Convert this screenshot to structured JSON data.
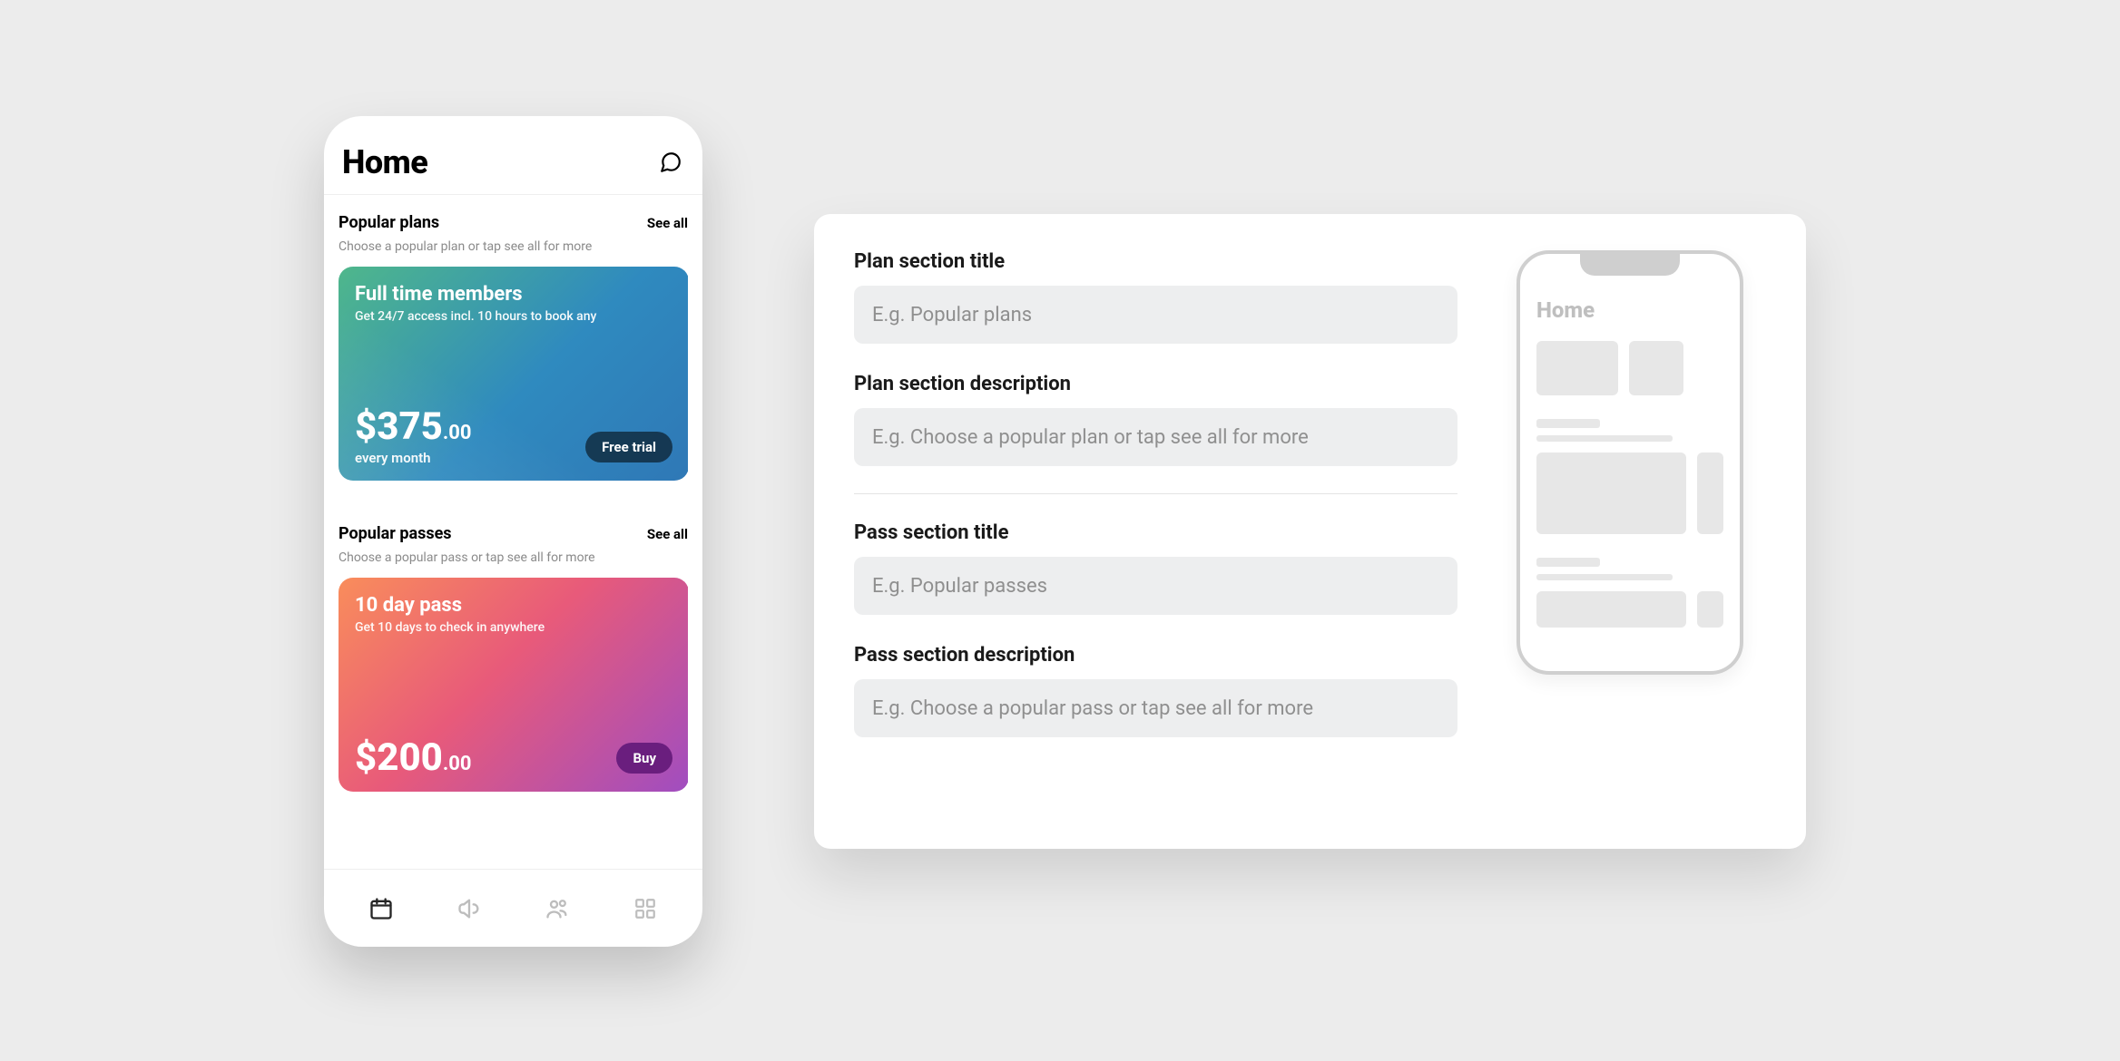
{
  "phone": {
    "title": "Home",
    "plans": {
      "heading": "Popular plans",
      "see_all": "See all",
      "description": "Choose a popular plan or tap see all for more",
      "card": {
        "name": "Full time members",
        "sub": "Get 24/7 access incl. 10 hours to book any",
        "price": "$375",
        "cents": ".00",
        "period": "every month",
        "cta": "Free trial"
      }
    },
    "passes": {
      "heading": "Popular passes",
      "see_all": "See all",
      "description": "Choose a popular pass or tap see all for more",
      "card": {
        "name": "10 day pass",
        "sub": "Get 10 days to check in anywhere",
        "price": "$200",
        "cents": ".00",
        "cta": "Buy"
      }
    }
  },
  "form": {
    "plan_title_label": "Plan section title",
    "plan_title_placeholder": "E.g. Popular plans",
    "plan_desc_label": "Plan section description",
    "plan_desc_placeholder": "E.g. Choose a popular plan or tap see all for more",
    "pass_title_label": "Pass section title",
    "pass_title_placeholder": "E.g. Popular passes",
    "pass_desc_label": "Pass section description",
    "pass_desc_placeholder": "E.g. Choose a popular pass or tap see all for more"
  },
  "preview": {
    "title": "Home"
  }
}
